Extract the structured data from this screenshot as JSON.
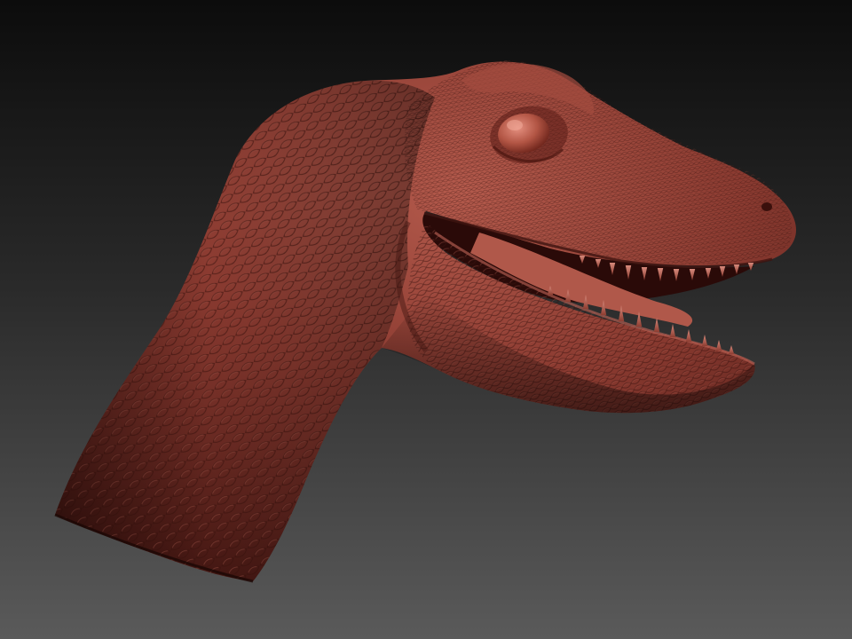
{
  "scene": {
    "subject": "dinosaur-head-sculpt",
    "colors": {
      "background_top": "#0c0c0c",
      "background_bottom": "#5a5a5a",
      "skin_base": "#8a3a30",
      "skin_highlight": "#b45a4c",
      "skin_shadow": "#3e1410",
      "mouth_interior": "#2a0a08",
      "tooth": "#c97a6c",
      "tongue": "#b0584a"
    }
  }
}
